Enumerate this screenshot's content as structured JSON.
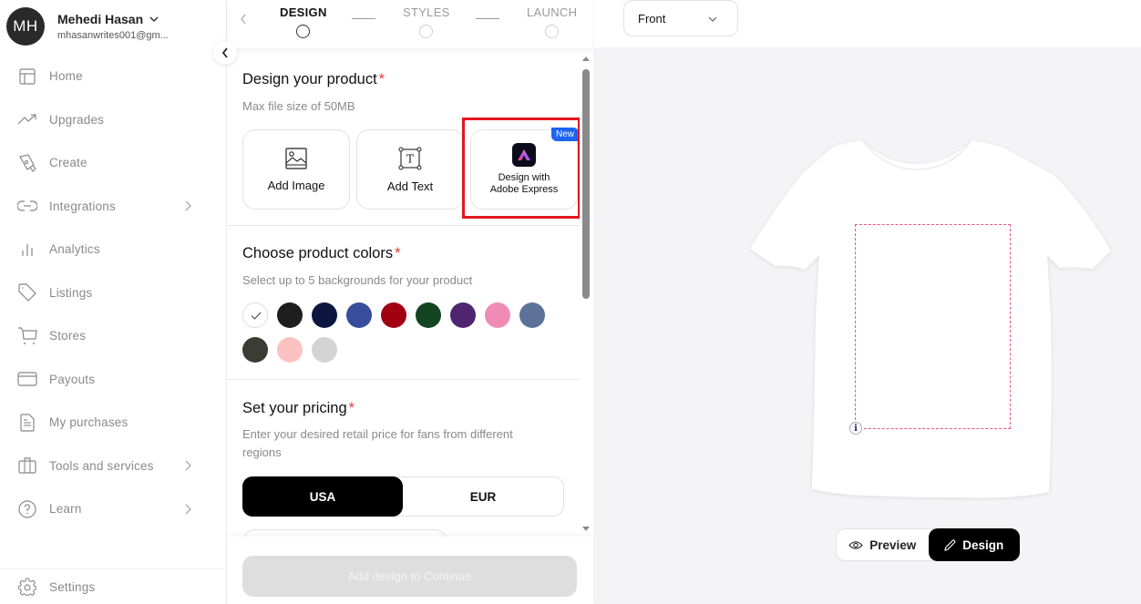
{
  "user": {
    "initials": "MH",
    "name": "Mehedi Hasan",
    "email": "mhasanwrites001@gm..."
  },
  "sidebar": {
    "items": [
      {
        "label": "Home",
        "icon": "layout-icon",
        "has_chevron": false
      },
      {
        "label": "Upgrades",
        "icon": "trend-up-icon",
        "has_chevron": false
      },
      {
        "label": "Create",
        "icon": "pen-tool-icon",
        "has_chevron": false
      },
      {
        "label": "Integrations",
        "icon": "link-icon",
        "has_chevron": true
      },
      {
        "label": "Analytics",
        "icon": "bar-chart-icon",
        "has_chevron": false
      },
      {
        "label": "Listings",
        "icon": "tag-icon",
        "has_chevron": false
      },
      {
        "label": "Stores",
        "icon": "cart-icon",
        "has_chevron": false
      },
      {
        "label": "Payouts",
        "icon": "card-icon",
        "has_chevron": false
      },
      {
        "label": "My purchases",
        "icon": "document-icon",
        "has_chevron": false
      },
      {
        "label": "Tools and services",
        "icon": "briefcase-icon",
        "has_chevron": true
      },
      {
        "label": "Learn",
        "icon": "help-circle-icon",
        "has_chevron": true
      }
    ],
    "settings_label": "Settings"
  },
  "stepper": {
    "steps": [
      {
        "label": "DESIGN",
        "active": true
      },
      {
        "label": "STYLES",
        "active": false
      },
      {
        "label": "LAUNCH",
        "active": false
      }
    ]
  },
  "design_section": {
    "title": "Design your product",
    "required_mark": "*",
    "subtitle": "Max file size of 50MB",
    "cards": [
      {
        "label": "Add Image",
        "icon": "image-icon"
      },
      {
        "label": "Add Text",
        "icon": "text-box-icon"
      },
      {
        "label_line1": "Design with",
        "label_line2": "Adobe Express",
        "icon": "adobe-express-icon",
        "badge": "New"
      }
    ]
  },
  "colors_section": {
    "title": "Choose product colors",
    "required_mark": "*",
    "subtitle": "Select up to 5 backgrounds for your product",
    "swatches": [
      {
        "name": "white",
        "hex": "#ffffff",
        "selected": true
      },
      {
        "name": "black",
        "hex": "#1e1e1e",
        "selected": false
      },
      {
        "name": "navy",
        "hex": "#0c1640",
        "selected": false
      },
      {
        "name": "royal-blue",
        "hex": "#384d9c",
        "selected": false
      },
      {
        "name": "red",
        "hex": "#a00012",
        "selected": false
      },
      {
        "name": "forest-green",
        "hex": "#124520",
        "selected": false
      },
      {
        "name": "purple",
        "hex": "#4f2470",
        "selected": false
      },
      {
        "name": "pink",
        "hex": "#f08bb5",
        "selected": false
      },
      {
        "name": "slate-blue",
        "hex": "#5d7299",
        "selected": false
      },
      {
        "name": "charcoal",
        "hex": "#3c3c34",
        "selected": false
      },
      {
        "name": "light-pink",
        "hex": "#fcc2c2",
        "selected": false
      },
      {
        "name": "light-gray",
        "hex": "#d4d4d4",
        "selected": false
      }
    ]
  },
  "pricing_section": {
    "title": "Set your pricing",
    "required_mark": "*",
    "subtitle": "Enter your desired retail price for fans from different regions",
    "regions": [
      {
        "label": "USA",
        "active": true
      },
      {
        "label": "EUR",
        "active": false
      }
    ]
  },
  "footer": {
    "continue_label": "Add design to Continue",
    "disabled": true
  },
  "preview": {
    "side_select": "Front",
    "info_label": "i",
    "modes": [
      {
        "label": "Preview",
        "icon": "eye-icon",
        "active": false
      },
      {
        "label": "Design",
        "icon": "pencil-icon",
        "active": true
      }
    ]
  },
  "colors": {
    "highlight": "#e3161f",
    "badge": "#1d64f2",
    "required": "#e53935",
    "print_area_border": "#f0508a"
  }
}
